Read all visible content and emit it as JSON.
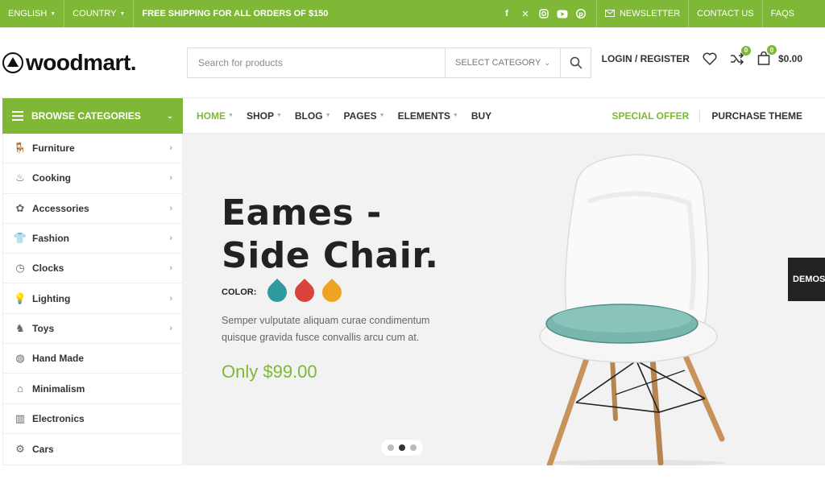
{
  "topbar": {
    "language": "ENGLISH",
    "country": "COUNTRY",
    "promo": "FREE SHIPPING FOR ALL ORDERS OF $150",
    "social": [
      "facebook-icon",
      "x-icon",
      "instagram-icon",
      "youtube-icon",
      "pinterest-icon"
    ],
    "newsletter": "NEWSLETTER",
    "contact": "CONTACT US",
    "faqs": "FAQS"
  },
  "header": {
    "logo": "woodmart.",
    "search_placeholder": "Search for products",
    "category_select": "SELECT CATEGORY",
    "login": "LOGIN / REGISTER",
    "compare_count": "0",
    "cart_count": "0",
    "cart_total": "$0.00"
  },
  "nav": {
    "browse_label": "BROWSE CATEGORIES",
    "items": [
      "HOME",
      "SHOP",
      "BLOG",
      "PAGES",
      "ELEMENTS",
      "BUY"
    ],
    "special": "SPECIAL OFFER",
    "purchase": "PURCHASE THEME"
  },
  "categories": [
    {
      "label": "Furniture",
      "icon": "chair-icon",
      "has_sub": true
    },
    {
      "label": "Cooking",
      "icon": "cooking-icon",
      "has_sub": true
    },
    {
      "label": "Accessories",
      "icon": "accessories-icon",
      "has_sub": true
    },
    {
      "label": "Fashion",
      "icon": "shirt-icon",
      "has_sub": true
    },
    {
      "label": "Clocks",
      "icon": "clock-icon",
      "has_sub": true
    },
    {
      "label": "Lighting",
      "icon": "bulb-icon",
      "has_sub": true
    },
    {
      "label": "Toys",
      "icon": "toy-icon",
      "has_sub": true
    },
    {
      "label": "Hand Made",
      "icon": "handmade-icon",
      "has_sub": false
    },
    {
      "label": "Minimalism",
      "icon": "minimalism-icon",
      "has_sub": false
    },
    {
      "label": "Electronics",
      "icon": "electronics-icon",
      "has_sub": false
    },
    {
      "label": "Cars",
      "icon": "car-icon",
      "has_sub": false
    }
  ],
  "hero": {
    "title_line1": "Eames -",
    "title_line2": "Side Chair.",
    "color_label": "COLOR:",
    "swatches": [
      "#2e9aa0",
      "#d9443c",
      "#efa323"
    ],
    "description": "Semper vulputate aliquam curae condimentum quisque gravida fusce convallis arcu cum at.",
    "price": "Only $99.00",
    "slide_current": 2,
    "slide_total": 3
  },
  "demos_label": "DEMOS",
  "colors": {
    "accent": "#7fb836"
  }
}
